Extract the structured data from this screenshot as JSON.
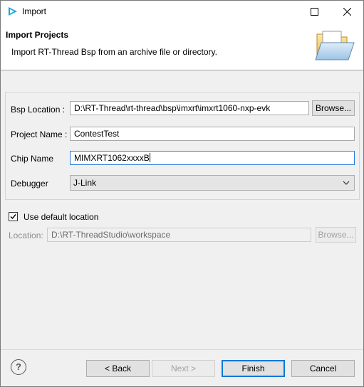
{
  "window": {
    "title": "Import"
  },
  "banner": {
    "title": "Import Projects",
    "description": "Import RT-Thread Bsp from an archive file or directory."
  },
  "form": {
    "bsp_location_label": "Bsp Location :",
    "bsp_location_value": "D:\\RT-Thread\\rt-thread\\bsp\\imxrt\\imxrt1060-nxp-evk",
    "browse_label": "Browse...",
    "project_name_label": "Project Name :",
    "project_name_value": "ContestTest",
    "chip_name_label": "Chip Name",
    "chip_name_value": "MIMXRT1062xxxxB",
    "debugger_label": "Debugger",
    "debugger_value": "J-Link"
  },
  "location": {
    "use_default_label": "Use default location",
    "use_default_checked": true,
    "location_label": "Location:",
    "location_value": "D:\\RT-ThreadStudio\\workspace",
    "browse_label": "Browse..."
  },
  "footer": {
    "help_symbol": "?",
    "back_label": "< Back",
    "next_label": "Next >",
    "finish_label": "Finish",
    "cancel_label": "Cancel"
  },
  "colors": {
    "accent": "#0078d7",
    "app_icon": "#1aa3dc"
  }
}
